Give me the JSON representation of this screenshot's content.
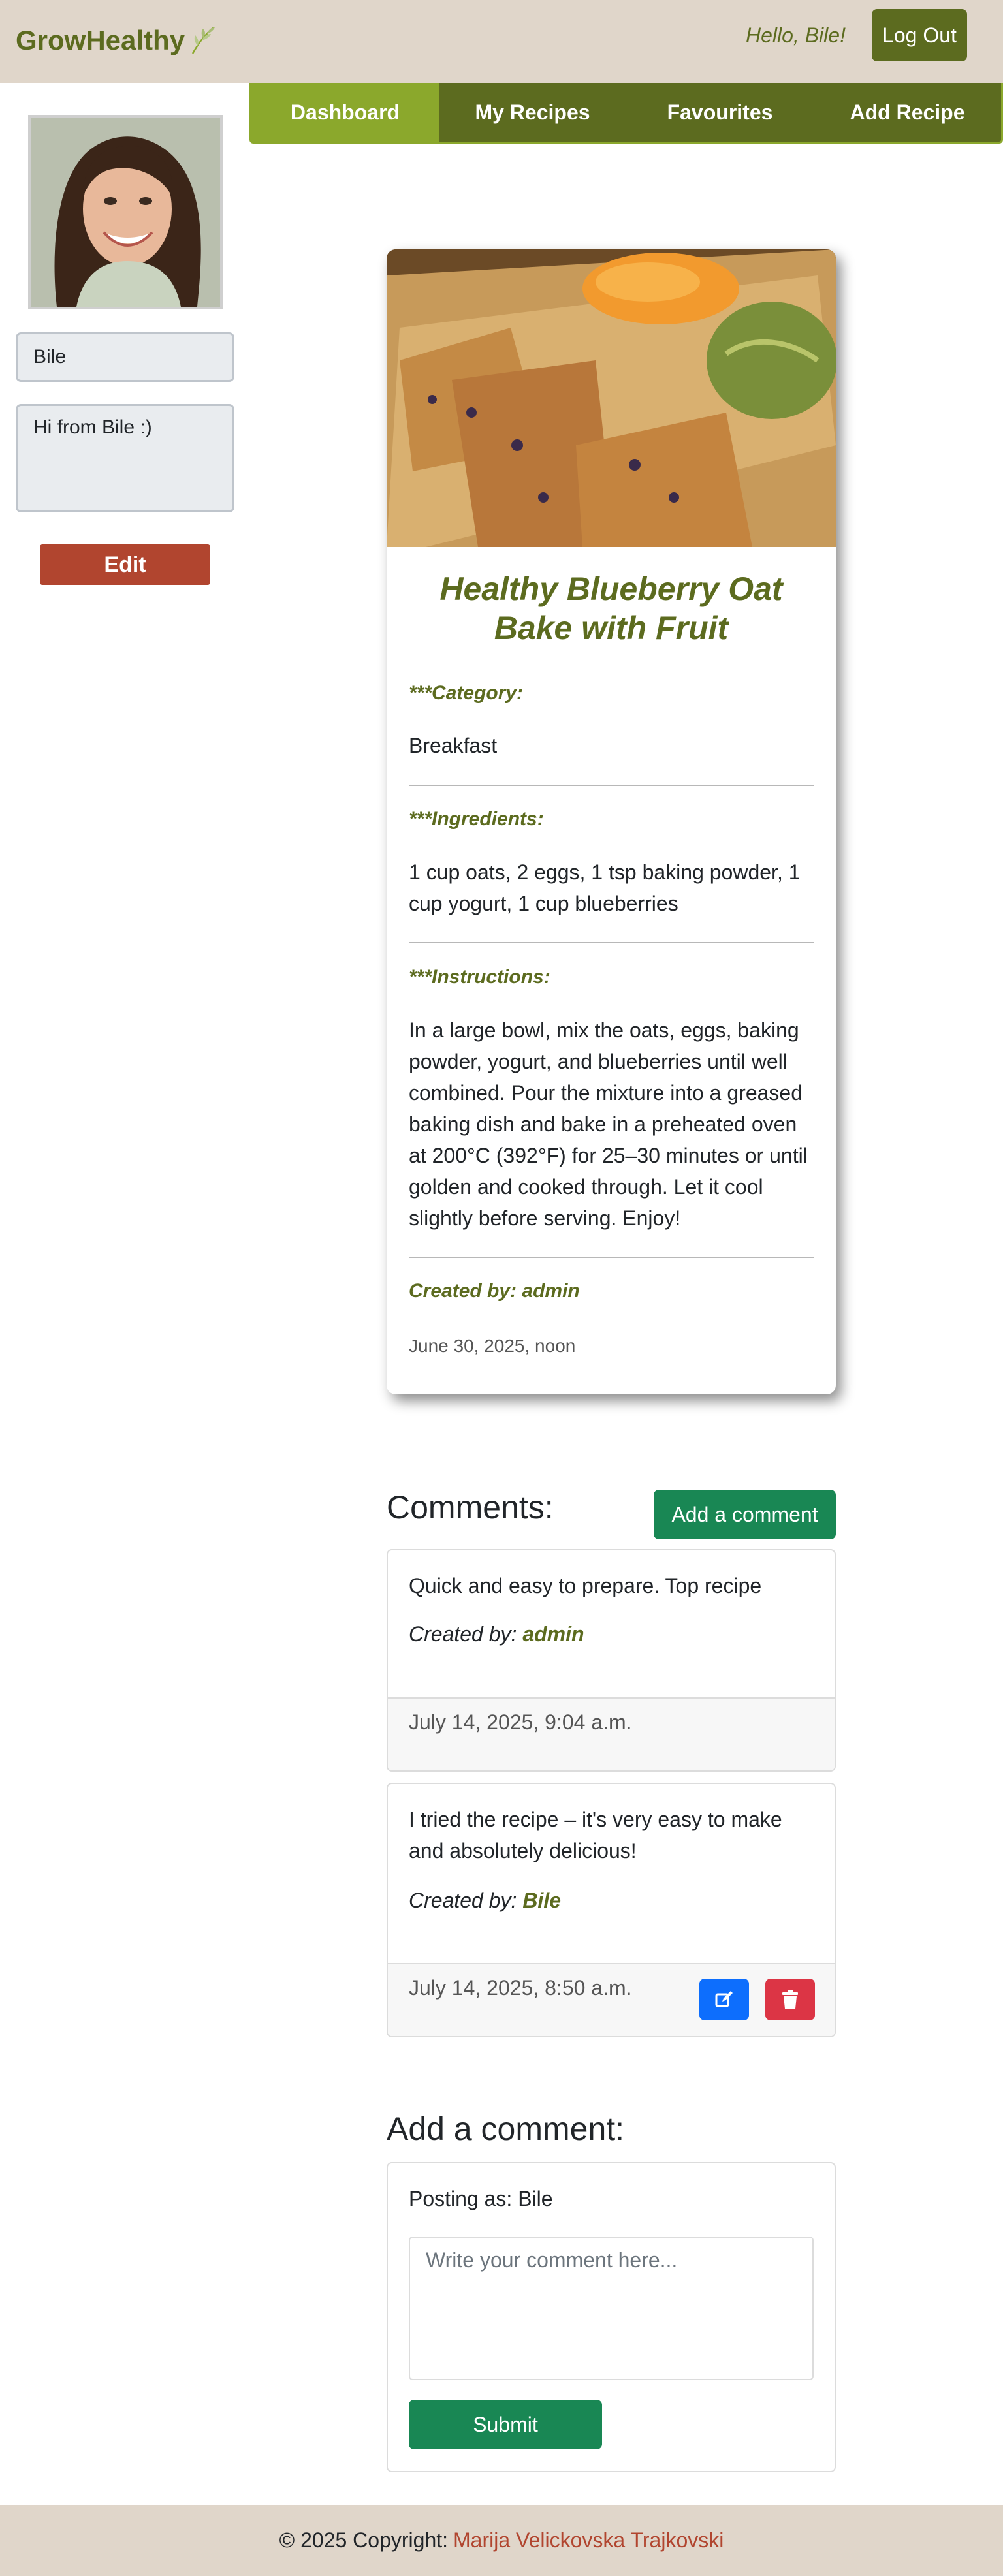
{
  "header": {
    "brand": "GrowHealthy",
    "greeting": "Hello, Bile!",
    "logout_label": "Log Out"
  },
  "nav": {
    "items": [
      {
        "label": "Dashboard",
        "active": true
      },
      {
        "label": "My Recipes"
      },
      {
        "label": "Favourites"
      },
      {
        "label": "Add Recipe"
      }
    ]
  },
  "profile": {
    "name": "Bile",
    "bio": "Hi from Bile :)",
    "edit_label": "Edit"
  },
  "recipe": {
    "title": "Healthy Blueberry Oat Bake with Fruit",
    "category_label": "***Category:",
    "category": "Breakfast",
    "ingredients_label": "***Ingredients:",
    "ingredients": "1 cup oats, 2 eggs, 1 tsp baking powder, 1 cup yogurt, 1 cup blueberries",
    "instructions_label": "***Instructions:",
    "instructions": "In a large bowl, mix the oats, eggs, baking powder, yogurt, and blueberries until well combined. Pour the mixture into a greased baking dish and bake in a preheated oven at 200°C (392°F) for 25–30 minutes or until golden and cooked through. Let it cool slightly before serving. Enjoy!",
    "created_by": "Created by: admin",
    "date": "June 30, 2025, noon"
  },
  "comments": {
    "title": "Comments:",
    "add_label": "Add a comment",
    "items": [
      {
        "text": "Quick and easy to prepare. Top recipe",
        "by_prefix": "Created by:",
        "author": "admin",
        "date": "July 14, 2025, 9:04 a.m."
      },
      {
        "text": "I tried the recipe – it's very easy to make and absolutely delicious!",
        "by_prefix": "Created by:",
        "author": "Bile",
        "date": "July 14, 2025, 8:50 a.m."
      }
    ]
  },
  "comment_form": {
    "title": "Add a comment:",
    "posting_as": "Posting as: Bile",
    "placeholder": "Write your comment here...",
    "submit_label": "Submit"
  },
  "footer": {
    "copyright": "© 2025 Copyright:",
    "author": "Marija Velickovska Trajkovski"
  },
  "colors": {
    "brand": "#5c6b1f",
    "nav_active": "#8ba82c",
    "header_bg": "#e0d6ca",
    "edit": "#b1452f",
    "success": "#198754",
    "primary": "#0d6efd",
    "danger": "#dc3545"
  }
}
